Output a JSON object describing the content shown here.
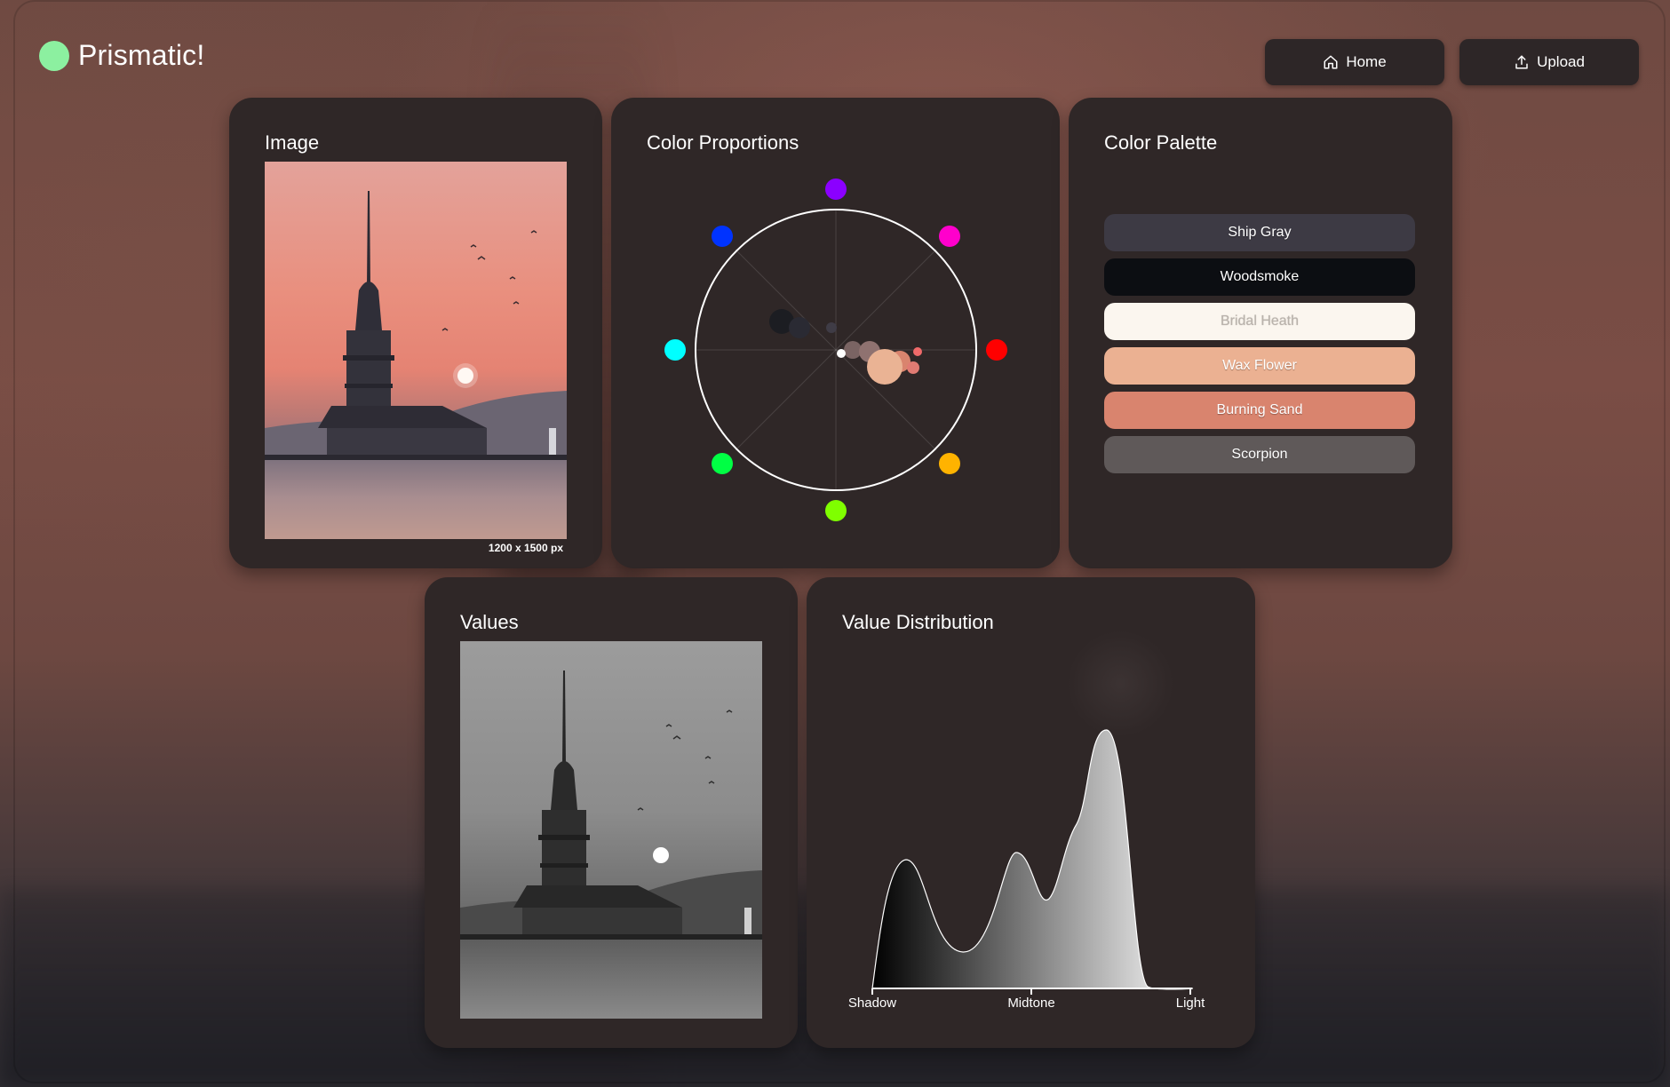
{
  "app": {
    "title": "Prismatic!"
  },
  "nav": {
    "home_label": "Home",
    "upload_label": "Upload"
  },
  "image_panel": {
    "title": "Image",
    "dimensions": "1200 x 1500 px"
  },
  "proportions_panel": {
    "title": "Color Proportions",
    "hue_markers": [
      {
        "name": "violet",
        "color": "#8b00ff"
      },
      {
        "name": "magenta",
        "color": "#ff00cc"
      },
      {
        "name": "red",
        "color": "#ff0000"
      },
      {
        "name": "orange",
        "color": "#ffb300"
      },
      {
        "name": "yellow-green",
        "color": "#7fff00"
      },
      {
        "name": "green",
        "color": "#00ff44"
      },
      {
        "name": "cyan",
        "color": "#00ffff"
      },
      {
        "name": "blue",
        "color": "#0033ff"
      }
    ]
  },
  "palette_panel": {
    "title": "Color Palette",
    "colors": [
      {
        "name": "Ship Gray",
        "hex": "#3d3a44",
        "text": "#ffffff"
      },
      {
        "name": "Woodsmoke",
        "hex": "#0c0e12",
        "text": "#ffffff"
      },
      {
        "name": "Bridal Heath",
        "hex": "#fbf6ef",
        "text": "#b9b2ab"
      },
      {
        "name": "Wax Flower",
        "hex": "#ebb192",
        "text": "#ffffff"
      },
      {
        "name": "Burning Sand",
        "hex": "#d9846e",
        "text": "#ffffff"
      },
      {
        "name": "Scorpion",
        "hex": "#5f5959",
        "text": "#ffffff"
      }
    ]
  },
  "values_panel": {
    "title": "Values"
  },
  "distribution_panel": {
    "title": "Value Distribution",
    "axis_labels": [
      "Shadow",
      "Midtone",
      "Light"
    ]
  },
  "icons": {
    "home": "home-icon",
    "upload": "upload-icon"
  }
}
